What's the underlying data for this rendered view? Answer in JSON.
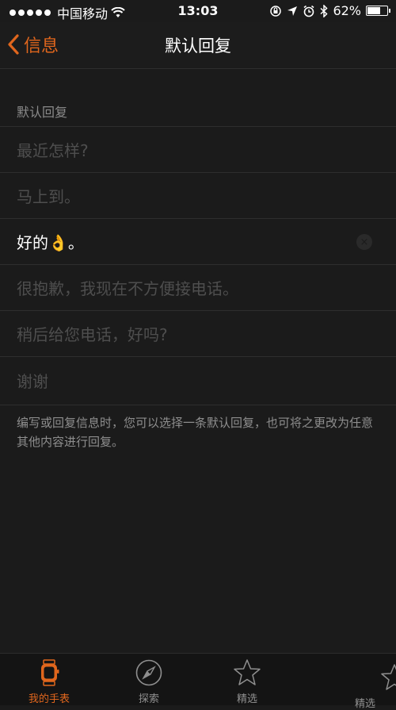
{
  "status_bar": {
    "carrier": "中国移动",
    "time": "13:03",
    "battery": "62%",
    "battery_level": 0.62,
    "signal_bars": 5
  },
  "nav": {
    "back_label": "信息",
    "title": "默认回复"
  },
  "section_header": "默认回复",
  "replies": [
    {
      "text": "最近怎样?"
    },
    {
      "text": "马上到。"
    },
    {
      "text": "好的👌。"
    },
    {
      "text": "很抱歉，我现在不方便接电话。"
    },
    {
      "text": "稍后给您电话，好吗?"
    },
    {
      "text": "谢谢"
    }
  ],
  "footer_note": "编写或回复信息时，您可以选择一条默认回复，也可将之更改为任意其他内容进行回复。",
  "tabs": [
    {
      "label": "我的手表",
      "icon": "watch-icon"
    },
    {
      "label": "探索",
      "icon": "compass-icon"
    },
    {
      "label": "精选",
      "icon": "star-icon"
    },
    {
      "label": "精选",
      "icon": "star-icon"
    }
  ],
  "colors": {
    "accent": "#e0661d",
    "background": "#1b1b1b",
    "placeholder_text": "#4e4e4e"
  }
}
